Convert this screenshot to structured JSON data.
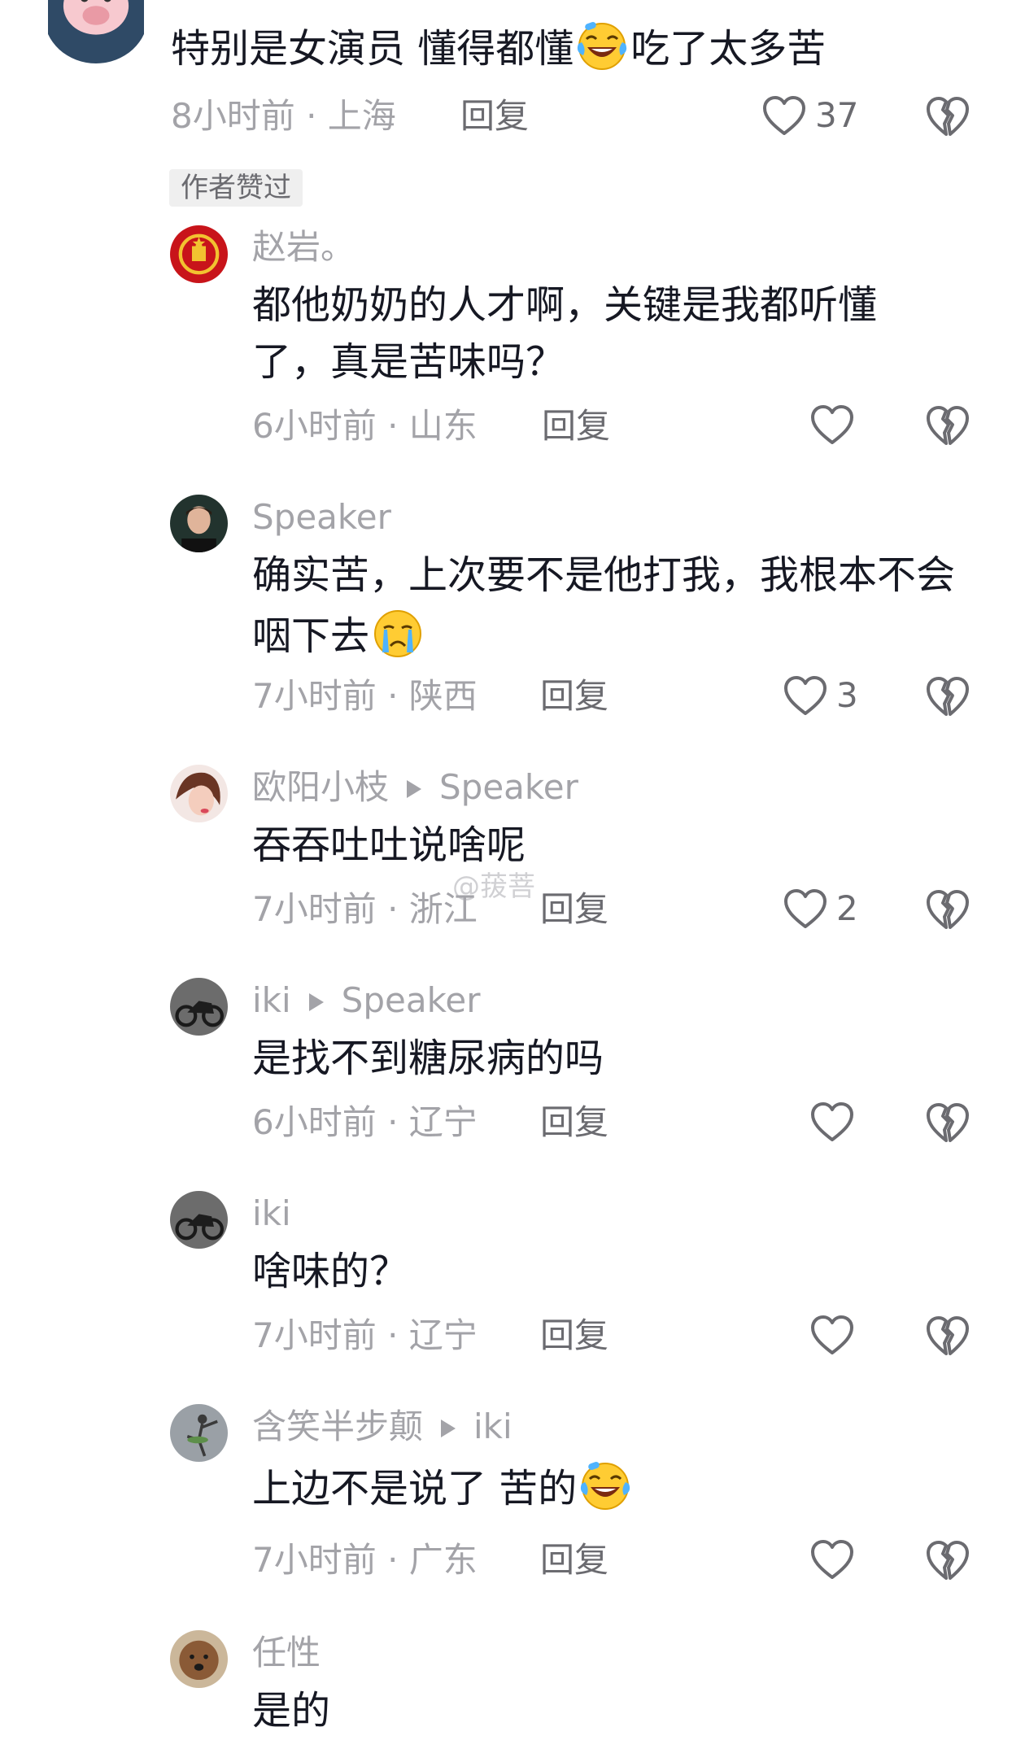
{
  "comments": [
    {
      "user": "",
      "text": "特别是女演员 懂得都懂",
      "text_after_emoji": "吃了太多苦",
      "time_loc": "8小时前 · 上海",
      "reply": "回复",
      "likes": "37",
      "badge": "作者赞过",
      "emoji": "laughing-crying-emoji"
    },
    {
      "user": "赵岩。",
      "text": "都他奶奶的人才啊，关键是我都听懂了，真是苦味吗？",
      "time_loc": "6小时前 · 山东",
      "reply": "回复",
      "likes": ""
    },
    {
      "user": "Speaker",
      "text": "确实苦，上次要不是他打我，我根本不会咽下去",
      "time_loc": "7小时前 · 陕西",
      "reply": "回复",
      "likes": "3",
      "emoji": "crying-emoji"
    },
    {
      "user": "欧阳小枝",
      "reply_to": "Speaker",
      "text": "吞吞吐吐说啥呢",
      "time_loc": "7小时前 · 浙江",
      "reply": "回复",
      "likes": "2"
    },
    {
      "user": "iki",
      "reply_to": "Speaker",
      "text": "是找不到糖尿病的吗",
      "time_loc": "6小时前 · 辽宁",
      "reply": "回复",
      "likes": ""
    },
    {
      "user": "iki",
      "text": "啥味的？",
      "time_loc": "7小时前 · 辽宁",
      "reply": "回复",
      "likes": ""
    },
    {
      "user": "含笑半步颠",
      "reply_to": "iki",
      "text": "上边不是说了 苦的",
      "time_loc": "7小时前 · 广东",
      "reply": "回复",
      "likes": "",
      "emoji": "laughing-crying-emoji"
    },
    {
      "user": "任性",
      "text": "是的",
      "time_loc": "",
      "reply": "",
      "likes": ""
    }
  ],
  "watermark": "@菝菩",
  "colors": {
    "text": "#161823",
    "muted": "#a3a3a8",
    "action": "#6b6b70",
    "badge_bg": "#efefef"
  }
}
